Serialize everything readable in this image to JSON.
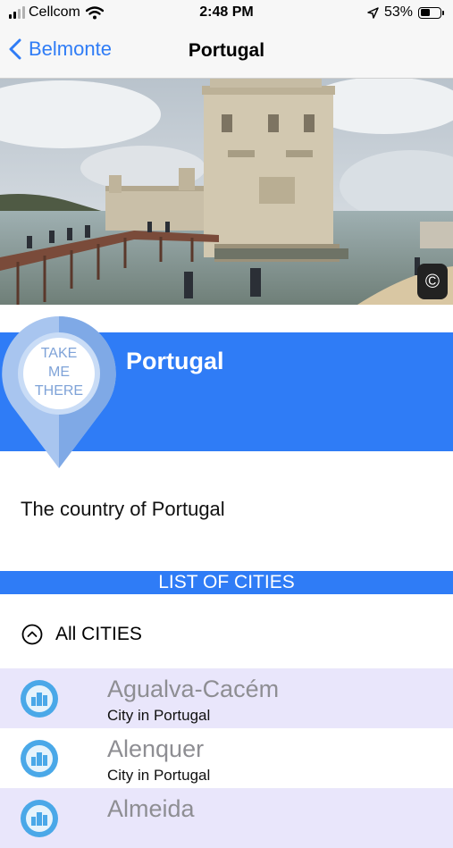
{
  "status_bar": {
    "carrier": "Cellcom",
    "time": "2:48 PM",
    "battery_text": "53%",
    "battery_level": 0.53,
    "icons": [
      "signal-icon",
      "wifi-icon",
      "location-arrow-icon",
      "battery-icon"
    ]
  },
  "nav": {
    "back_label": "Belmonte",
    "title": "Portugal"
  },
  "hero": {
    "copyright_symbol": "©"
  },
  "pin": {
    "line1": "TAKE",
    "line2": "ME",
    "line3": "THERE"
  },
  "country": {
    "name": "Portugal",
    "description": "The country of Portugal"
  },
  "section": {
    "title": "LIST OF CITIES"
  },
  "filter": {
    "label": "All CITIES"
  },
  "cities": [
    {
      "name": "Agualva-Cacém",
      "subtitle": "City in Portugal"
    },
    {
      "name": "Alenquer",
      "subtitle": "City in Portugal"
    },
    {
      "name": "Almeida",
      "subtitle": ""
    }
  ],
  "colors": {
    "accent": "#2f7cf6",
    "row_alt": "#e9e6fb",
    "city_name": "#8e8e93"
  }
}
